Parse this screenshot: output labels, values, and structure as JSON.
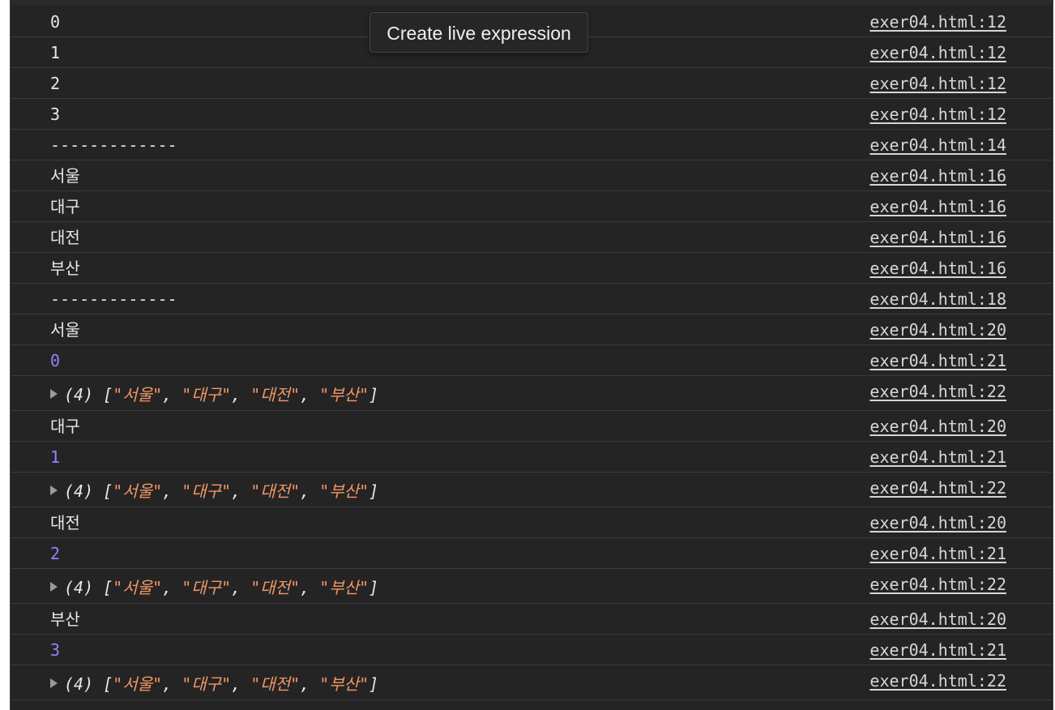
{
  "tooltip": {
    "text": "Create live expression"
  },
  "rows": [
    {
      "text": "0",
      "source": "exer04.html:12"
    },
    {
      "text": "1",
      "source": "exer04.html:12"
    },
    {
      "text": "2",
      "source": "exer04.html:12"
    },
    {
      "text": "3",
      "source": "exer04.html:12"
    },
    {
      "text": "-------------",
      "source": "exer04.html:14"
    },
    {
      "text": "서울",
      "source": "exer04.html:16"
    },
    {
      "text": "대구",
      "source": "exer04.html:16"
    },
    {
      "text": "대전",
      "source": "exer04.html:16"
    },
    {
      "text": "부산",
      "source": "exer04.html:16"
    },
    {
      "text": "-------------",
      "source": "exer04.html:18"
    },
    {
      "text": "서울",
      "source": "exer04.html:20"
    },
    {
      "text": "0",
      "source": "exer04.html:21"
    },
    {
      "array_count": "(4)",
      "array_items": [
        "서울",
        "대구",
        "대전",
        "부산"
      ],
      "source": "exer04.html:22"
    },
    {
      "text": "대구",
      "source": "exer04.html:20"
    },
    {
      "text": "1",
      "source": "exer04.html:21"
    },
    {
      "array_count": "(4)",
      "array_items": [
        "서울",
        "대구",
        "대전",
        "부산"
      ],
      "source": "exer04.html:22"
    },
    {
      "text": "대전",
      "source": "exer04.html:20"
    },
    {
      "text": "2",
      "source": "exer04.html:21"
    },
    {
      "array_count": "(4)",
      "array_items": [
        "서울",
        "대구",
        "대전",
        "부산"
      ],
      "source": "exer04.html:22"
    },
    {
      "text": "부산",
      "source": "exer04.html:20"
    },
    {
      "text": "3",
      "source": "exer04.html:21"
    },
    {
      "array_count": "(4)",
      "array_items": [
        "서울",
        "대구",
        "대전",
        "부산"
      ],
      "source": "exer04.html:22"
    }
  ],
  "colors": {
    "background": "#242424",
    "number": "#9980ff",
    "string": "#f29766",
    "text": "#e8e8e8"
  }
}
